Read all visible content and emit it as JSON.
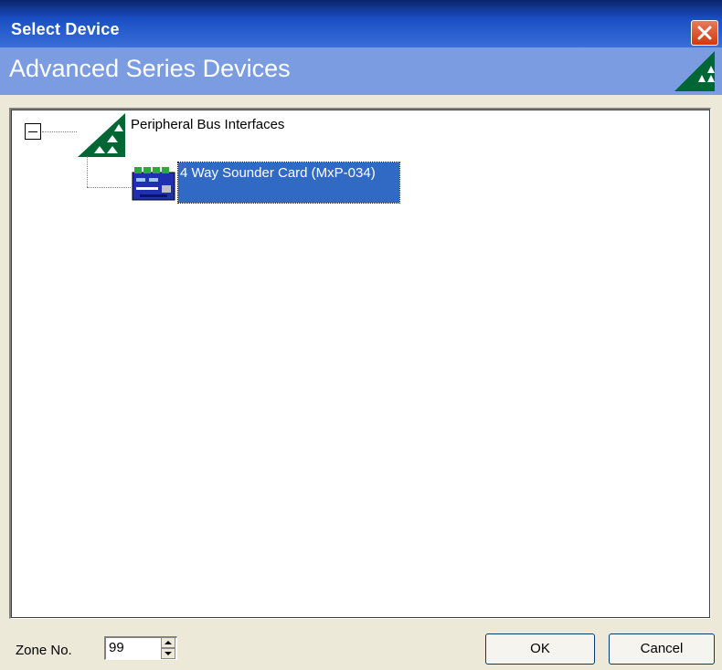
{
  "window": {
    "title": "Select Device"
  },
  "header": {
    "title": "Advanced Series Devices"
  },
  "tree": {
    "root": {
      "label": "Peripheral Bus Interfaces",
      "expanded": true,
      "icon": "triangle-logo-icon"
    },
    "children": [
      {
        "label": "4 Way Sounder Card (MxP-034)",
        "selected": true,
        "icon": "sounder-card-icon"
      }
    ]
  },
  "zone": {
    "label": "Zone No.",
    "value": "99"
  },
  "buttons": {
    "ok": "OK",
    "cancel": "Cancel"
  },
  "colors": {
    "title_bar": "#1a4fc4",
    "header_band": "#7b9ce0",
    "selection": "#316ac5",
    "logo_green": "#006633"
  }
}
